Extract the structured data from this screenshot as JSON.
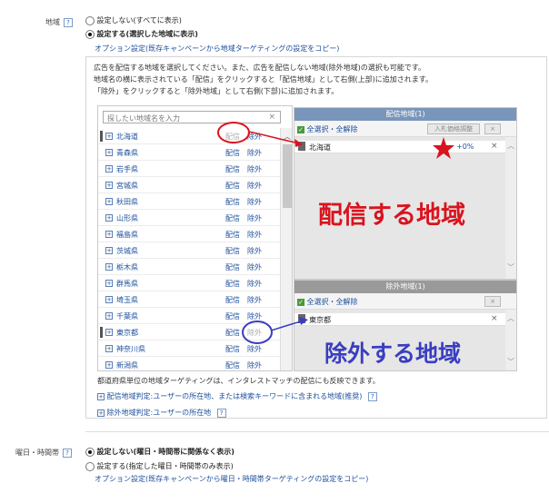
{
  "region_section": {
    "label": "地域",
    "help": "?",
    "option_none": "設定しない(すべてに表示)",
    "option_set": "設定する(選択した地域に表示)",
    "copy_link": "オプション設定(既存キャンペーンから地域ターゲティングの設定をコピー)",
    "selected_option": "set"
  },
  "instructions": [
    "広告を配信する地域を選択してください。また、広告を配信しない地域(除外地域)の選択も可能です。",
    "地域名の横に表示されている「配信」をクリックすると「配信地域」として右側(上部)に追加されます。",
    "「除外」をクリックすると「除外地域」として右側(下部)に追加されます。"
  ],
  "search": {
    "placeholder": "探したい地域名を入力",
    "clear": "×"
  },
  "prefectures": [
    {
      "name": "北海道",
      "deliver": "配信",
      "exclude": "除外",
      "state": "delivered"
    },
    {
      "name": "青森県",
      "deliver": "配信",
      "exclude": "除外",
      "state": ""
    },
    {
      "name": "岩手県",
      "deliver": "配信",
      "exclude": "除外",
      "state": ""
    },
    {
      "name": "宮城県",
      "deliver": "配信",
      "exclude": "除外",
      "state": ""
    },
    {
      "name": "秋田県",
      "deliver": "配信",
      "exclude": "除外",
      "state": ""
    },
    {
      "name": "山形県",
      "deliver": "配信",
      "exclude": "除外",
      "state": ""
    },
    {
      "name": "福島県",
      "deliver": "配信",
      "exclude": "除外",
      "state": ""
    },
    {
      "name": "茨城県",
      "deliver": "配信",
      "exclude": "除外",
      "state": ""
    },
    {
      "name": "栃木県",
      "deliver": "配信",
      "exclude": "除外",
      "state": ""
    },
    {
      "name": "群馬県",
      "deliver": "配信",
      "exclude": "除外",
      "state": ""
    },
    {
      "name": "埼玉県",
      "deliver": "配信",
      "exclude": "除外",
      "state": ""
    },
    {
      "name": "千葉県",
      "deliver": "配信",
      "exclude": "除外",
      "state": ""
    },
    {
      "name": "東京都",
      "deliver": "配信",
      "exclude": "除外",
      "state": "excluded"
    },
    {
      "name": "神奈川県",
      "deliver": "配信",
      "exclude": "除外",
      "state": ""
    },
    {
      "name": "新潟県",
      "deliver": "配信",
      "exclude": "除外",
      "state": ""
    }
  ],
  "delivery_panel": {
    "header": "配信地域(1)",
    "select_all": "全選択・全解除",
    "bid_button": "入札価格調整",
    "remove": "×",
    "items": [
      {
        "name": "北海道",
        "bid": "+0%",
        "remove": "×"
      }
    ],
    "annotation": "配信する地域"
  },
  "exclusion_panel": {
    "header": "除外地域(1)",
    "select_all": "全選択・全解除",
    "remove": "×",
    "items": [
      {
        "name": "東京都",
        "remove": "×"
      }
    ],
    "annotation": "除外する地域"
  },
  "notes": {
    "interest_match": "都道府県単位の地域ターゲティングは、インタレストマッチの配信にも反映できます。",
    "delivery_judgment": "配信地域判定:ユーザーの所在地、または検索キーワードに含まれる地域(推奨)",
    "exclusion_judgment": "除外地域判定:ユーザーの所在地",
    "help": "?"
  },
  "daytime_section": {
    "label": "曜日・時間帯",
    "help": "?",
    "option_none": "設定しない(曜日・時間帯に関係なく表示)",
    "option_set": "設定する(指定した曜日・時間帯のみ表示)",
    "copy_link": "オプション設定(既存キャンペーンから曜日・時間帯ターゲティングの設定をコピー)",
    "selected_option": "none"
  },
  "colors": {
    "accent_red": "#d8141e",
    "accent_blue": "#3a3ec0",
    "header_blue": "#7a95ba",
    "link": "#1d4f9c"
  }
}
